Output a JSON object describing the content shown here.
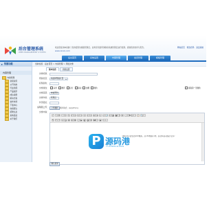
{
  "header": {
    "logo_title": "后台管理系统",
    "logo_subtitle": "WEB MANAGEMENT SYSTEM",
    "notice_line1": "欢迎您使用本系统！您的权限为超级管理员，如有任何疑问请联系系统管理员进行处理，感谢您的支持与配合。",
    "notice_line2": "www.xxxxx.com",
    "top_links": [
      "网站首页",
      "修改密码",
      "退出系统"
    ],
    "nav_tabs": [
      "后台首页",
      "系统设置",
      "内容管理",
      "会员管理",
      "模板管理"
    ]
  },
  "sidebar": {
    "title": "快捷功能",
    "subtitle": "内容管理",
    "items": [
      {
        "label": "内容管理",
        "child": false
      },
      {
        "label": "新闻资讯",
        "child": true
      },
      {
        "label": "公司动态",
        "child": true
      },
      {
        "label": "行业新闻",
        "child": true
      },
      {
        "label": "产品展示",
        "child": true
      },
      {
        "label": "成功案例",
        "child": true
      },
      {
        "label": "解决方案",
        "child": true
      },
      {
        "label": "技术支持",
        "child": true
      },
      {
        "label": "下载中心",
        "child": true
      },
      {
        "label": "在线留言",
        "child": true
      },
      {
        "label": "招聘信息",
        "child": true
      },
      {
        "label": "友情链接",
        "child": true
      },
      {
        "label": "关于我们",
        "child": true
      }
    ]
  },
  "main": {
    "breadcrumb": "当前位置：后台首页 > 内容管理 > 添加文章",
    "subtabs": [
      "基本信息",
      "高级设置"
    ],
    "form": {
      "title_label": "文章标题：",
      "title_value": "",
      "category_label": "所属栏目：",
      "category_value": "请选择所属栏目",
      "color_label": "标题颜色：",
      "color_value": "",
      "attr_label": "文章属性：",
      "attrs": [
        "头条",
        "推荐",
        "幻灯",
        "滚动",
        "加粗",
        "图片"
      ],
      "source_label": "文章来源：",
      "source_value": "本站原创",
      "author_label": "文章作者：",
      "author_value": "管理员",
      "outer_link_label": "外部链接：",
      "thumb_label": "缩略图上传：",
      "upload_button": "上传图片",
      "thumb_hint": "图片格式：jpg/gif/png",
      "auto_thumb": "提取第一张图片",
      "content_label": "文章内容：",
      "annotation": "（图片大小建议宽200像素，高150像素以内，超过将自动缩小显示）",
      "submit_label": "确认提交"
    },
    "editor_toolbar_row1": [
      "↶",
      "↷",
      "B",
      "I",
      "U",
      "S",
      "x²",
      "x₂",
      "A",
      "≡",
      "≡",
      "≡",
      "≡",
      "☰",
      "☰",
      "⇤",
      "⇥",
      "🔗",
      "⚓",
      "▦",
      "▣",
      "☺",
      "Ω",
      "—",
      "⌫",
      "⎘",
      "✂",
      "📋",
      "🔍",
      "⛶"
    ],
    "editor_toolbar_row2": [
      "¶",
      "F",
      "T",
      "A",
      "▤",
      "⊞",
      "⊟",
      "⊠",
      "♫",
      "▶",
      "◧",
      "◨",
      "❖",
      "⌨",
      "☐",
      "◉",
      "✎",
      "✓"
    ]
  },
  "watermark": {
    "letter": "P",
    "text": "源码港",
    "sub": "YUANMAGANG"
  },
  "colors": {
    "brand": "#1f6cbf",
    "nav_tab": "#2b7fd0",
    "sidebar_bg": "#eaf1f9",
    "watermark": "#2a9be0"
  }
}
